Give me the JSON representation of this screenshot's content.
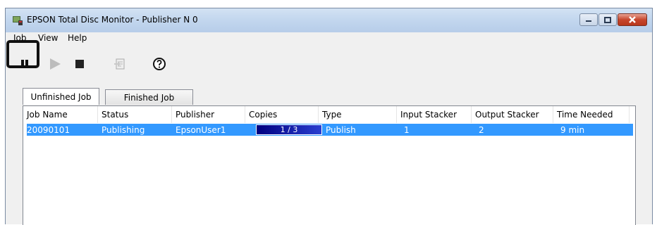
{
  "window": {
    "title": "EPSON Total Disc Monitor - Publisher N 0"
  },
  "menu": [
    "Job",
    "View",
    "Help"
  ],
  "toolbar": {
    "buttons": [
      "pause-icon",
      "play-icon",
      "stop-icon",
      "document-icon",
      "help-icon"
    ],
    "highlighted": "pause-icon"
  },
  "tabs": [
    "Unfinished Job",
    "Finished Job"
  ],
  "active_tab": "Unfinished Job",
  "columns": [
    "Job Name",
    "Status",
    "Publisher",
    "Copies",
    "Type",
    "Input Stacker",
    "Output Stacker",
    "Time Needed"
  ],
  "rows": [
    {
      "job_name": "20090101",
      "status": "Publishing",
      "publisher": "EpsonUser1",
      "copies": "1 / 3",
      "type": "Publish",
      "input_stacker": "1",
      "output_stacker": "2",
      "time_needed": "9 min"
    }
  ],
  "colors": {
    "selection": "#3399ff",
    "progress": "#000080"
  }
}
